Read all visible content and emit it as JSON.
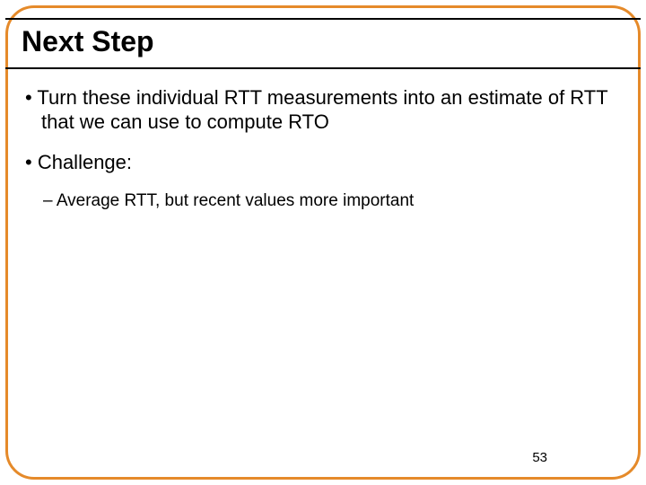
{
  "title": "Next Step",
  "bullets": {
    "b1": "Turn these individual RTT measurements into an estimate of RTT that we can use to compute RTO",
    "b2": "Challenge:",
    "b2_sub1": "Average RTT, but recent values more important"
  },
  "page_number": "53"
}
